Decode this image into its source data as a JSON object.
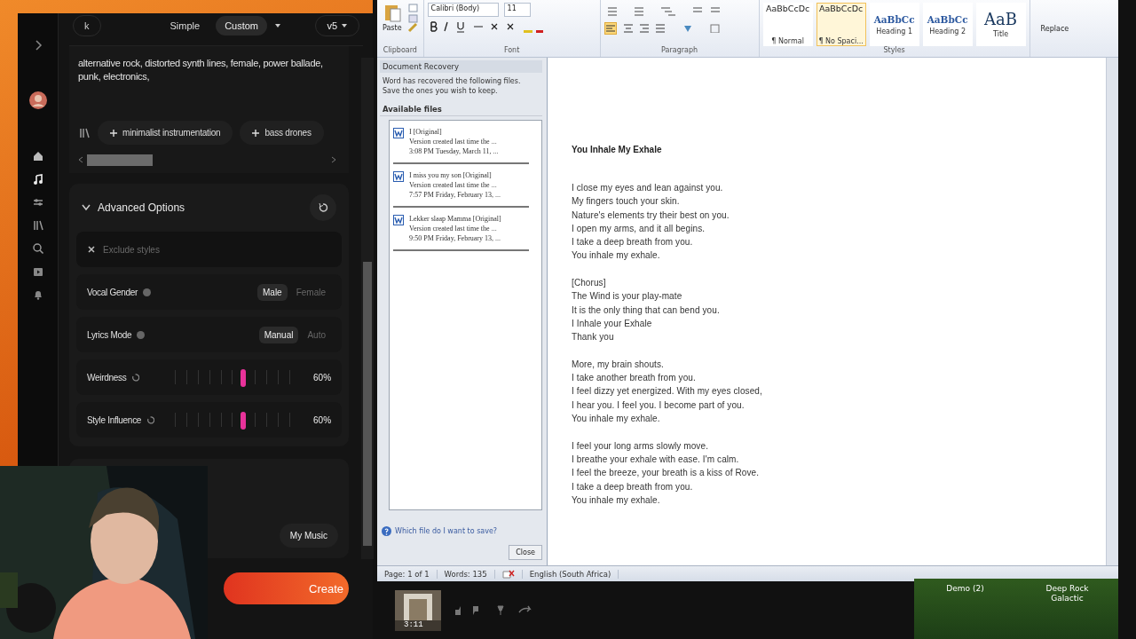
{
  "suno": {
    "top_bar": {
      "back_label": "k",
      "modes": [
        {
          "label": "Simple",
          "selected": false
        },
        {
          "label": "Custom",
          "selected": true
        }
      ],
      "model": "v5"
    },
    "style_text": "alternative rock,  distorted synth lines, female, power ballade, punk, electronics,",
    "tags": [
      "minimalist instrumentation",
      "bass drones"
    ],
    "advanced": {
      "title": "Advanced Options",
      "expanded": true,
      "exclude_placeholder": "Exclude styles",
      "toggles": [
        {
          "label": "Vocal Gender",
          "options": [
            {
              "label": "Male",
              "selected": true
            },
            {
              "label": "Female",
              "selected": false
            }
          ]
        },
        {
          "label": "Lyrics Mode",
          "options": [
            {
              "label": "Manual",
              "selected": true
            },
            {
              "label": "Auto",
              "selected": false
            }
          ]
        }
      ],
      "sliders": [
        {
          "label": "Weirdness",
          "level": 0.6,
          "reading": "60%"
        },
        {
          "label": "Style Influence",
          "level": 0.6,
          "reading": "60%"
        }
      ]
    },
    "my_music": "My Music",
    "create": "Create"
  },
  "word": {
    "ribbon": {
      "paste": "Paste",
      "font_name": "Calibri (Body)",
      "font_size": "11",
      "replace": "Replace",
      "groups": [
        "Clipboard",
        "Font",
        "Paragraph",
        "Styles"
      ],
      "styles": [
        {
          "preview": "AaBbCcDc",
          "label": "¶ Normal",
          "kind": "body",
          "selected": false
        },
        {
          "preview": "AaBbCcDc",
          "label": "¶ No Spaci...",
          "kind": "body",
          "selected": true
        },
        {
          "preview": "AaBbCc",
          "label": "Heading 1",
          "kind": "heading",
          "selected": false
        },
        {
          "preview": "AaBbCc",
          "label": "Heading 2",
          "kind": "heading",
          "selected": false
        },
        {
          "preview": "AaB",
          "label": "Title",
          "kind": "title",
          "selected": false
        }
      ]
    },
    "recovery": {
      "title": "Document Recovery",
      "message": "Word has recovered the following files.  Save the ones you wish to keep.",
      "list_title": "Available files",
      "files": [
        {
          "name": "I  [Original]",
          "detail": "Version created last time the ...",
          "time": "3:08 PM Tuesday, March 11, ..."
        },
        {
          "name": "I miss you my son  [Original]",
          "detail": "Version created last time the ...",
          "time": "7:57 PM Friday, February 13, ..."
        },
        {
          "name": "Lekker slaap Mamma  [Original]",
          "detail": "Version created last time the ...",
          "time": "9:50 PM Friday, February 13, ..."
        }
      ],
      "help_link": "Which file do I want to save?",
      "close": "Close"
    },
    "document": {
      "title": "You Inhale My Exhale",
      "stanzas": [
        [
          "I close my eyes and lean against you.",
          "My fingers touch your skin.",
          "Nature's elements try their best on you.",
          "I open my arms, and it all begins.",
          "I take a deep breath from you.",
          "You inhale my exhale."
        ],
        [
          "[Chorus]",
          "The Wind is your play-mate",
          "It is the only thing that can bend you.",
          "I Inhale your Exhale",
          "Thank you"
        ],
        [
          "More, my brain shouts.",
          "I take another breath from you.",
          "I feel dizzy yet energized. With my eyes closed,",
          "I hear you.  I feel you.  I become part of you.",
          "You inhale my exhale."
        ],
        [
          "I feel your long arms slowly move.",
          "I breathe your exhale with ease. I'm calm.",
          "I feel the breeze, your breath is a kiss of Rove.",
          "I take a deep breath from you.",
          "You inhale my exhale."
        ]
      ]
    },
    "status_bar": {
      "page": "Page: 1 of 1",
      "words": "Words: 135",
      "language": "English (South Africa)"
    }
  },
  "bottom": {
    "duration": "3:11",
    "desktop_icons": [
      "Demo (2)",
      "Deep Rock Galactic"
    ]
  }
}
